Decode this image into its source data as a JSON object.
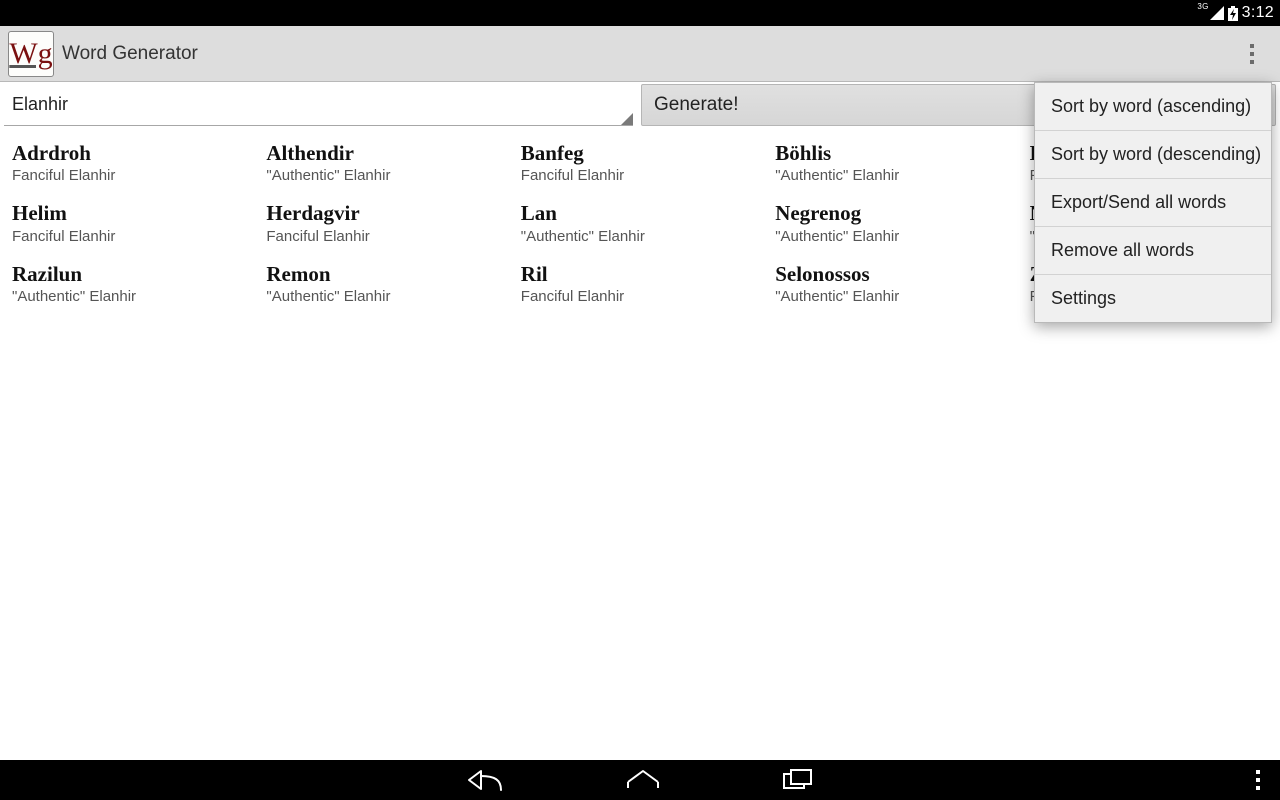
{
  "status": {
    "network_label": "3G",
    "clock": "3:12"
  },
  "actionbar": {
    "app_icon_text": "Wg",
    "title": "Word Generator"
  },
  "controls": {
    "spinner_value": "Elanhir",
    "generate_label": "Generate!"
  },
  "words": [
    {
      "word": "Adrdroh",
      "sub": "Fanciful Elanhir"
    },
    {
      "word": "Althendir",
      "sub": "\"Authentic\" Elanhir"
    },
    {
      "word": "Banfeg",
      "sub": "Fanciful Elanhir"
    },
    {
      "word": "Böhlis",
      "sub": "\"Authentic\" Elanhir"
    },
    {
      "word": "Dirdibdrur",
      "sub": "Fanciful Elanhir"
    },
    {
      "word": "Helim",
      "sub": "Fanciful Elanhir"
    },
    {
      "word": "Herdagvir",
      "sub": "Fanciful Elanhir"
    },
    {
      "word": "Lan",
      "sub": "\"Authentic\" Elanhir"
    },
    {
      "word": "Negrenog",
      "sub": "\"Authentic\" Elanhir"
    },
    {
      "word": "Nurak",
      "sub": "\"Authentic\" Elanhir"
    },
    {
      "word": "Razilun",
      "sub": "\"Authentic\" Elanhir"
    },
    {
      "word": "Remon",
      "sub": "\"Authentic\" Elanhir"
    },
    {
      "word": "Ril",
      "sub": "Fanciful Elanhir"
    },
    {
      "word": "Selonossos",
      "sub": "\"Authentic\" Elanhir"
    },
    {
      "word": "Zirnna",
      "sub": "Fanciful Elanhir"
    }
  ],
  "menu": {
    "items": [
      "Sort by word (ascending)",
      "Sort by word (descending)",
      "Export/Send all words",
      "Remove all words",
      "Settings"
    ]
  }
}
